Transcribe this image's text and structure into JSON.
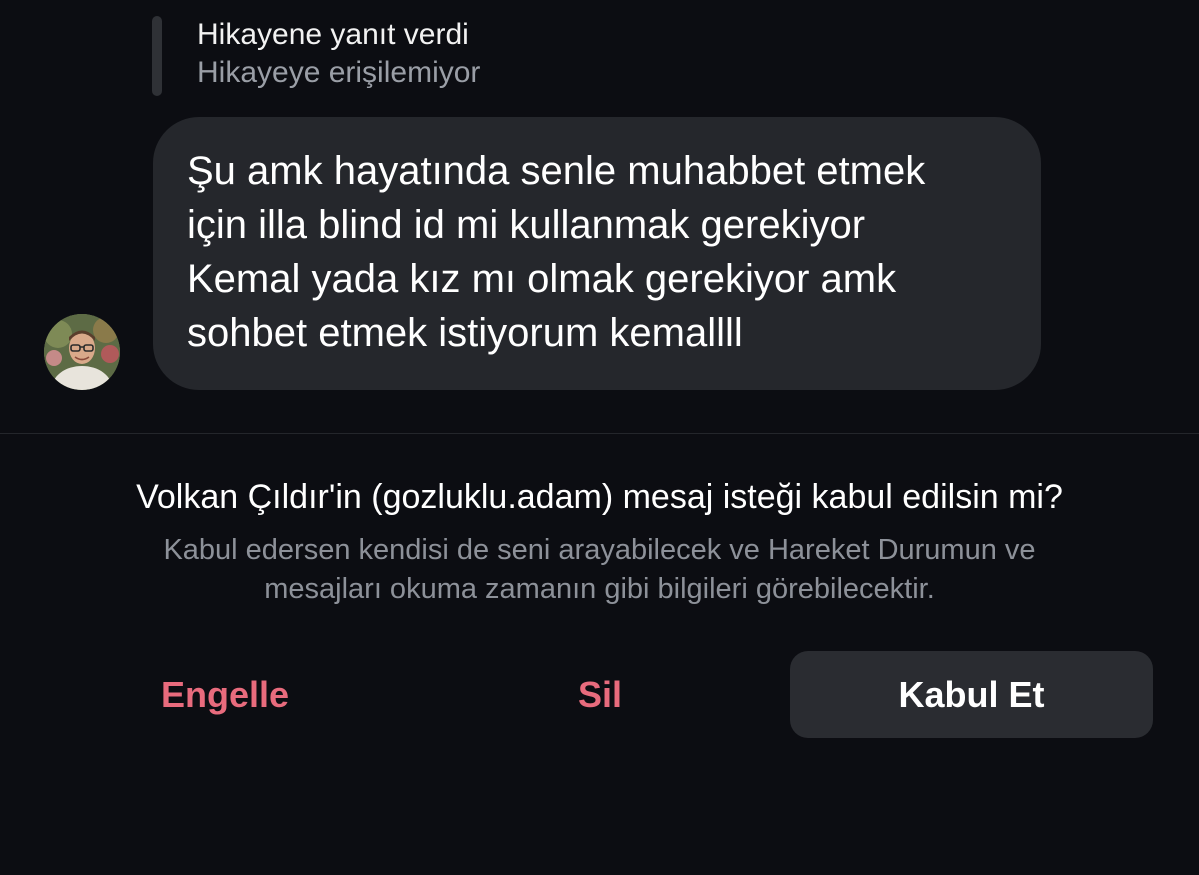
{
  "story_reply": {
    "title": "Hikayene yanıt verdi",
    "subtitle": "Hikayeye erişilemiyor"
  },
  "message": {
    "lines": [
      "Şu amk hayatında senle muhabbet etmek",
      "için illa blind id mi kullanmak gerekiyor",
      "Kemal yada kız mı olmak gerekiyor amk",
      "sohbet etmek istiyorum kemallll"
    ]
  },
  "request": {
    "title": "Volkan Çıldır'in (gozluklu.adam) mesaj isteği kabul edilsin mi?",
    "description_lines": [
      "Kabul edersen kendisi de seni arayabilecek ve Hareket Durumun ve",
      "mesajları okuma zamanın gibi bilgileri görebilecektir."
    ]
  },
  "actions": {
    "block_label": "Engelle",
    "delete_label": "Sil",
    "accept_label": "Kabul Et"
  },
  "colors": {
    "background": "#0c0d12",
    "bubble": "#25272c",
    "danger": "#e86b7d",
    "accept_button": "#2a2c31",
    "secondary_text": "#8d9199"
  }
}
